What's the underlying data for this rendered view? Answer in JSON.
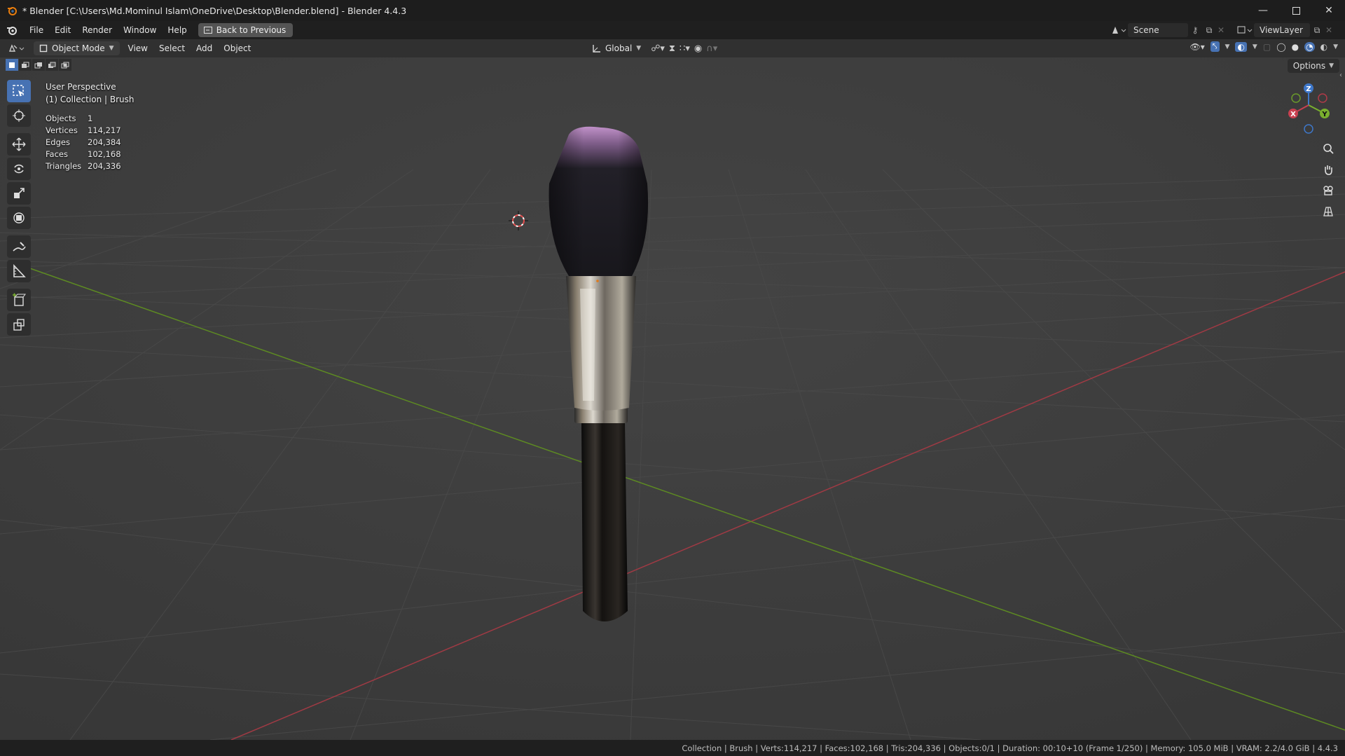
{
  "window": {
    "title": "* Blender [C:\\Users\\Md.Mominul Islam\\OneDrive\\Desktop\\Blender.blend] - Blender 4.4.3",
    "controls": [
      "minimize-icon",
      "maximize-icon",
      "close-icon"
    ]
  },
  "menu": {
    "items": [
      "File",
      "Edit",
      "Render",
      "Window",
      "Help"
    ],
    "back_button": "Back to Previous",
    "scene": "Scene",
    "view_layer": "ViewLayer"
  },
  "viewport_header": {
    "mode": "Object Mode",
    "menus": [
      "View",
      "Select",
      "Add",
      "Object"
    ],
    "orientation": "Global",
    "options": "Options"
  },
  "viewport": {
    "perspective": "User Perspective",
    "collection": "(1) Collection | Brush",
    "stats": [
      {
        "label": "Objects",
        "value": "1"
      },
      {
        "label": "Vertices",
        "value": "114,217"
      },
      {
        "label": "Edges",
        "value": "204,384"
      },
      {
        "label": "Faces",
        "value": "102,168"
      },
      {
        "label": "Triangles",
        "value": "204,336"
      }
    ],
    "gizmo_axes": {
      "x": "X",
      "y": "Y",
      "z": "Z"
    }
  },
  "toolbar": {
    "tools": [
      "select-box-icon",
      "cursor-icon",
      "move-icon",
      "rotate-icon",
      "scale-icon",
      "transform-icon",
      "annotate-icon",
      "measure-icon",
      "add-cube-icon",
      "add-object-icon"
    ]
  },
  "status": {
    "text": "Collection | Brush | Verts:114,217 | Faces:102,168 | Tris:204,336 | Objects:0/1 | Duration: 00:10+10 (Frame 1/250) | Memory: 105.0 MiB | VRAM: 2.2/4.0 GiB | 4.4.3"
  },
  "colors": {
    "accent": "#4772b3",
    "axis_x": "#b0404a",
    "axis_y": "#6a9a2a",
    "bristle_tip": "#b58ac0"
  }
}
